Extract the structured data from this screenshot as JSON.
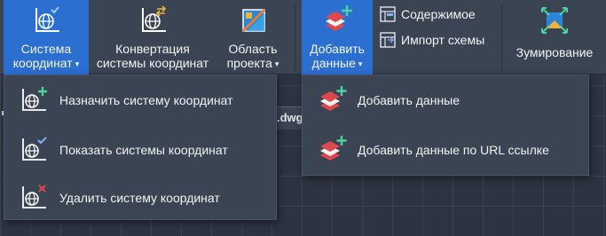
{
  "ribbon": {
    "coord_system": {
      "line1": "Система",
      "line2": "координат",
      "caret": "▾"
    },
    "convert": {
      "line1": "Конвертация",
      "line2": "системы координат"
    },
    "project_area": {
      "line1": "Область",
      "line2": "проекта",
      "caret": "▾"
    },
    "add_data": {
      "line1": "Добавить",
      "line2": "данные",
      "caret": "▾"
    },
    "contents": {
      "label": "Содержимое"
    },
    "schema_import": {
      "label": "Импорт схемы"
    },
    "zoom": {
      "label": "Зумирование"
    }
  },
  "coord_menu": {
    "items": [
      {
        "label": "Назначить систему координат",
        "badge": "plus"
      },
      {
        "label": "Показать системы координат",
        "badge": "check"
      },
      {
        "label": "Удалить систему координат",
        "badge": "x"
      }
    ]
  },
  "data_menu": {
    "items": [
      {
        "label": "Добавить данные"
      },
      {
        "label": "Добавить данные по URL ссылке"
      }
    ]
  },
  "canvas": {
    "file_tab": ".dwg"
  },
  "colors": {
    "ribbon_bg": "#3b4453",
    "active": "#2b6fd1",
    "badge_plus": "#4bd39a",
    "badge_check": "#7fb3ff",
    "badge_x": "#e0474c"
  }
}
